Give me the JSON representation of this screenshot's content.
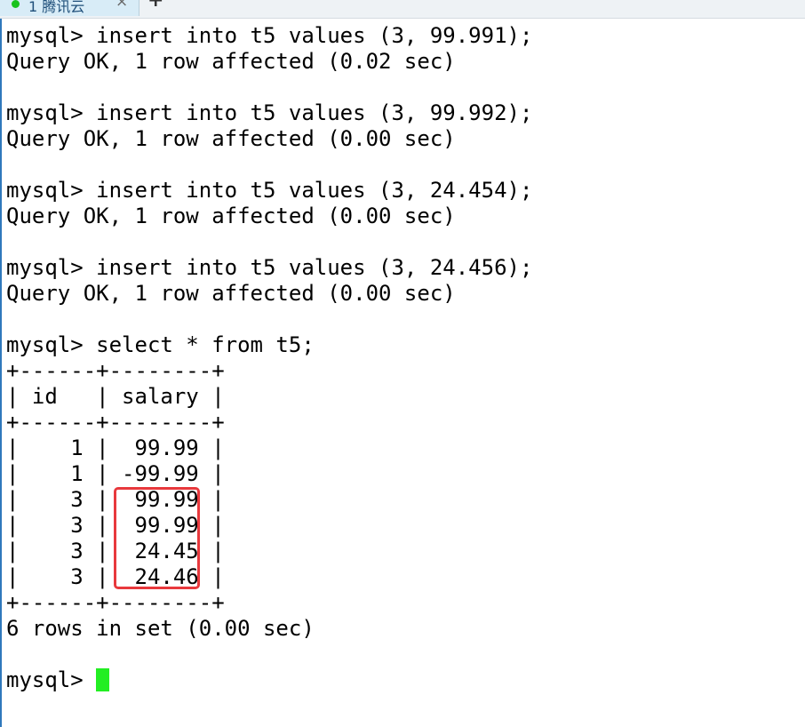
{
  "tab": {
    "title": "1 腾讯云",
    "close_glyph": "×",
    "new_glyph": "+",
    "status_color": "#19c31e"
  },
  "terminal": {
    "prompt": "mysql>",
    "cursor_color": "#22ee22",
    "lines": [
      "mysql> insert into t5 values (3, 99.991);",
      "Query OK, 1 row affected (0.02 sec)",
      "",
      "mysql> insert into t5 values (3, 99.992);",
      "Query OK, 1 row affected (0.00 sec)",
      "",
      "mysql> insert into t5 values (3, 24.454);",
      "Query OK, 1 row affected (0.00 sec)",
      "",
      "mysql> insert into t5 values (3, 24.456);",
      "Query OK, 1 row affected (0.00 sec)",
      "",
      "mysql> select * from t5;",
      "+------+--------+",
      "| id   | salary |",
      "+------+--------+",
      "|    1 |  99.99 |",
      "|    1 | -99.99 |",
      "|    3 |  99.99 |",
      "|    3 |  99.99 |",
      "|    3 |  24.45 |",
      "|    3 |  24.46 |",
      "+------+--------+",
      "6 rows in set (0.00 sec)",
      ""
    ]
  },
  "highlight": {
    "color": "#e8393d"
  }
}
